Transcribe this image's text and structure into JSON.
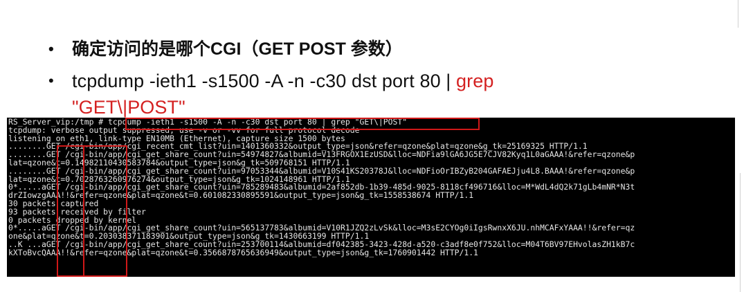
{
  "bullets": {
    "item1": "确定访问的是哪个CGI（GET POST 参数）",
    "item2_cmd": "tcpdump -ieth1 -s1500 -A -n -c30 dst port 80 | ",
    "item2_grep": "grep",
    "item2_pattern": "\"GET\\|POST\""
  },
  "terminal": {
    "lines": [
      "RS_Server_vip:/tmp # tcpdump -ieth1 -s1500 -A -n -c30 dst port 80 | grep \"GET\\|POST\"",
      "tcpdump: verbose output suppressed, use -v or -vv for full protocol decode",
      "listening on eth1, link-type EN10MB (Ethernet), capture size 1500 bytes",
      "........GET /cgi-bin/app/cgi_recent_cmt_list?uin=1401360332&output_type=json&refer=qzone&plat=qzone&g_tk=25169325 HTTP/1.1",
      "........GET /cgi-bin/app/cgi_get_share_count?uin=54974827&albumid=V13FRGOX1EzUSD&lloc=NDFia9lGA6JG5E7CJV82Kyq1L0aGAAA!&refer=qzone&p",
      "lat=qzone&t=0.14982110430583784&output_type=json&g_tk=509768151 HTTP/1.1",
      "........GET /cgi-bin/app/cgi_get_share_count?uin=97053344&albumid=V10S41KS20378J&lloc=NDFioOrIBZyB204GAFAEJju4L8.BAAA!&refer=qzone&p",
      "lat=qzone&t=0.7028763260976274&output_type=json&g_tk=1024148961 HTTP/1.1",
      "0*.....aGET /cgi-bin/app/cgi_get_share_count?uin=785289483&albumid=2af852db-1b39-485d-9025-8118cf496716&lloc=M*WdL4dQ2k71gLb4mNR*N3t",
      "drZIowzgAAA!!&refer=qzone&plat=qzone&t=0.601082330895591&output_type=json&g_tk=1558538674 HTTP/1.1",
      "30 packets captured",
      "93 packets received by filter",
      "0 packets dropped by kernel",
      "0*.....aGET /cgi-bin/app/cgi_get_share_count?uin=565137783&albumid=V10R1JZQ2zLvSk&lloc=M3sE2CYOg0iIgsRwnxX6JU.nhMCAFxYAAA!!&refer=qz",
      "one&plat=qzone&t=0.203038371183901&output_type=json&g_tk=1430663199 HTTP/1.1",
      "..K ...aGET /cgi-bin/app/cgi_get_share_count?uin=253700114&albumid=df042385-3423-428d-a520-c3adf8e0f752&lloc=M04T6BV97EHvolasZH1kB7c",
      "kXToBvcQAAA!!&refer=qzone&plat=qzone&t=0.3566878765636949&output_type=json&g_tk=1760901442 HTTP/1.1"
    ]
  },
  "colors": {
    "accent_red": "#d42121",
    "terminal_bg": "#000000",
    "terminal_fg": "#e6e6e6",
    "highlight_box": "#d01818"
  }
}
